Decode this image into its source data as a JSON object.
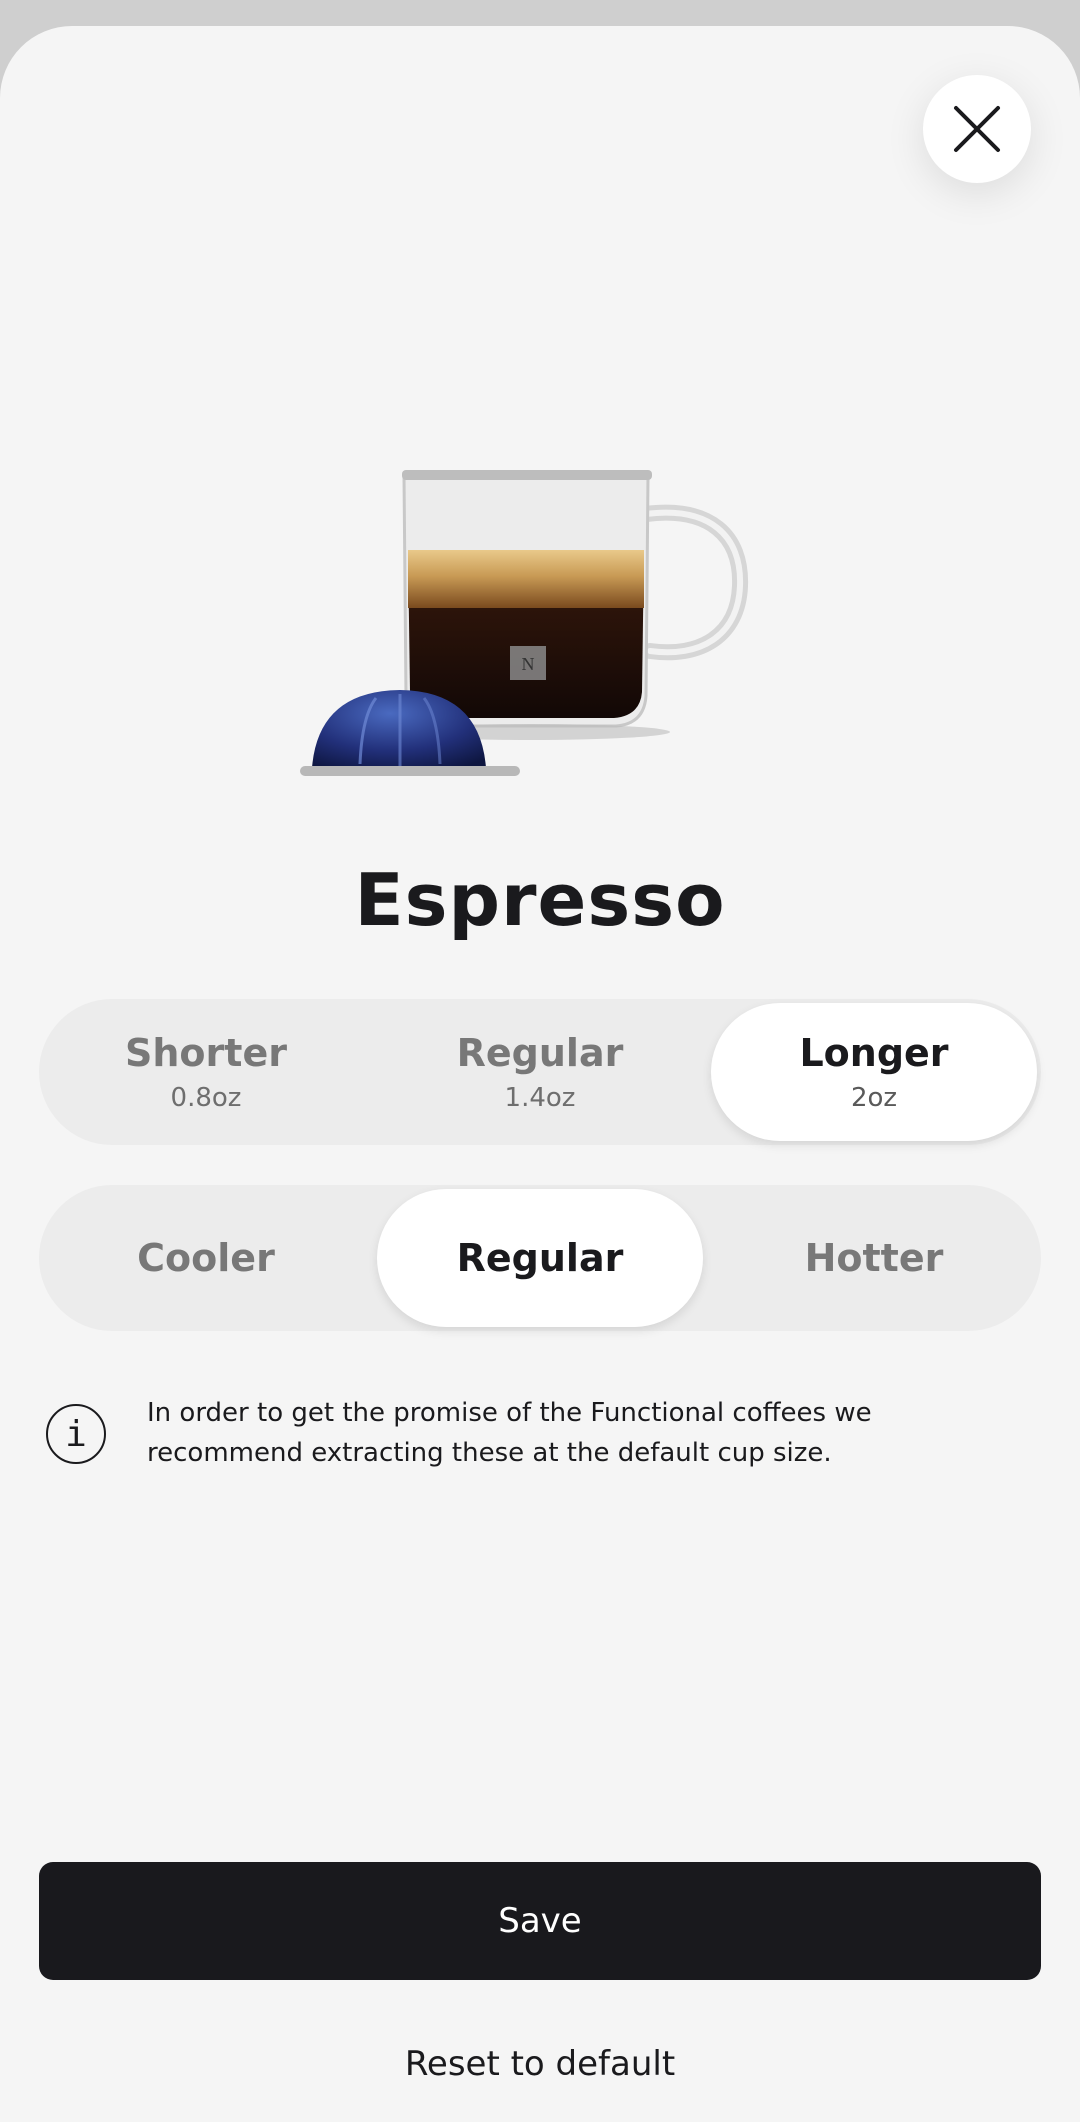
{
  "product": {
    "name": "Espresso"
  },
  "cup_size": {
    "selected": "Longer",
    "options": [
      {
        "label": "Shorter",
        "volume": "0.8oz"
      },
      {
        "label": "Regular",
        "volume": "1.4oz"
      },
      {
        "label": "Longer",
        "volume": "2oz"
      }
    ]
  },
  "temperature": {
    "selected": "Regular",
    "options": [
      {
        "label": "Cooler"
      },
      {
        "label": "Regular"
      },
      {
        "label": "Hotter"
      }
    ]
  },
  "info": {
    "icon": "info-icon",
    "message": "In order to get the promise of the Functional coffees we recommend extracting these at the default cup size."
  },
  "actions": {
    "save_label": "Save",
    "reset_label": "Reset to default"
  },
  "colors": {
    "primary_button": "#19191d",
    "background": "#f5f5f5",
    "selected_segment": "#ffffff"
  }
}
